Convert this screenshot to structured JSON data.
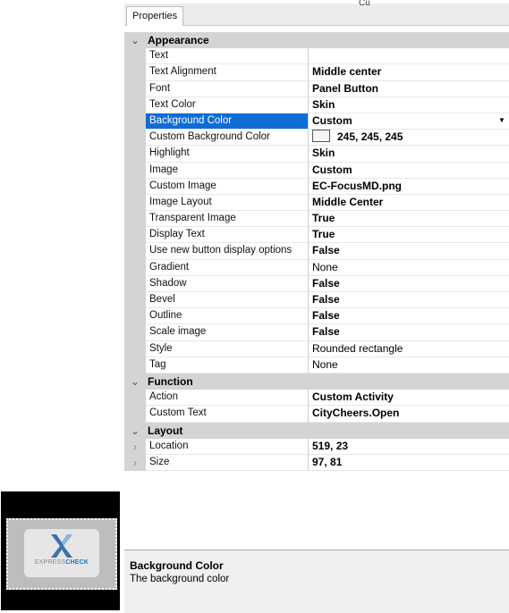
{
  "panel": {
    "tab_label": "Properties",
    "stray_text": "Cu"
  },
  "categories": {
    "appearance": "Appearance",
    "function": "Function",
    "layout": "Layout"
  },
  "properties": {
    "text": {
      "name": "Text",
      "value": ""
    },
    "text_alignment": {
      "name": "Text Alignment",
      "value": "Middle center"
    },
    "font": {
      "name": "Font",
      "value": "Panel Button"
    },
    "text_color": {
      "name": "Text Color",
      "value": "Skin"
    },
    "background_color": {
      "name": "Background Color",
      "value": "Custom"
    },
    "custom_background_color": {
      "name": "Custom Background Color",
      "value": "245, 245, 245"
    },
    "highlight": {
      "name": "Highlight",
      "value": "Skin"
    },
    "image": {
      "name": "Image",
      "value": "Custom"
    },
    "custom_image": {
      "name": "Custom Image",
      "value": "EC-FocusMD.png"
    },
    "image_layout": {
      "name": "Image Layout",
      "value": "Middle Center"
    },
    "transparent_image": {
      "name": "Transparent Image",
      "value": "True"
    },
    "display_text": {
      "name": "Display Text",
      "value": "True"
    },
    "use_new_button": {
      "name": "Use new button display options",
      "value": "False"
    },
    "gradient": {
      "name": "Gradient",
      "value": "None"
    },
    "shadow": {
      "name": "Shadow",
      "value": "False"
    },
    "bevel": {
      "name": "Bevel",
      "value": "False"
    },
    "outline": {
      "name": "Outline",
      "value": "False"
    },
    "scale_image": {
      "name": "Scale image",
      "value": "False"
    },
    "style": {
      "name": "Style",
      "value": "Rounded rectangle"
    },
    "tag": {
      "name": "Tag",
      "value": "None"
    },
    "action": {
      "name": "Action",
      "value": "Custom Activity"
    },
    "custom_text": {
      "name": "Custom Text",
      "value": "CityCheers.Open"
    },
    "location": {
      "name": "Location",
      "value": "519, 23"
    },
    "size": {
      "name": "Size",
      "value": "97, 81"
    }
  },
  "help": {
    "title": "Background Color",
    "description": "The background color"
  },
  "thumbnail": {
    "brand_left": "EXPRESS",
    "brand_right": "CHECK"
  },
  "colors": {
    "selection": "#0f6cd6",
    "category_bg": "#d4d4d4",
    "swatch": "#f5f5f5"
  },
  "icons": {
    "collapse": "chevron-down-icon",
    "expand": "chevron-right-icon",
    "dropdown": "dropdown-arrow-icon"
  }
}
